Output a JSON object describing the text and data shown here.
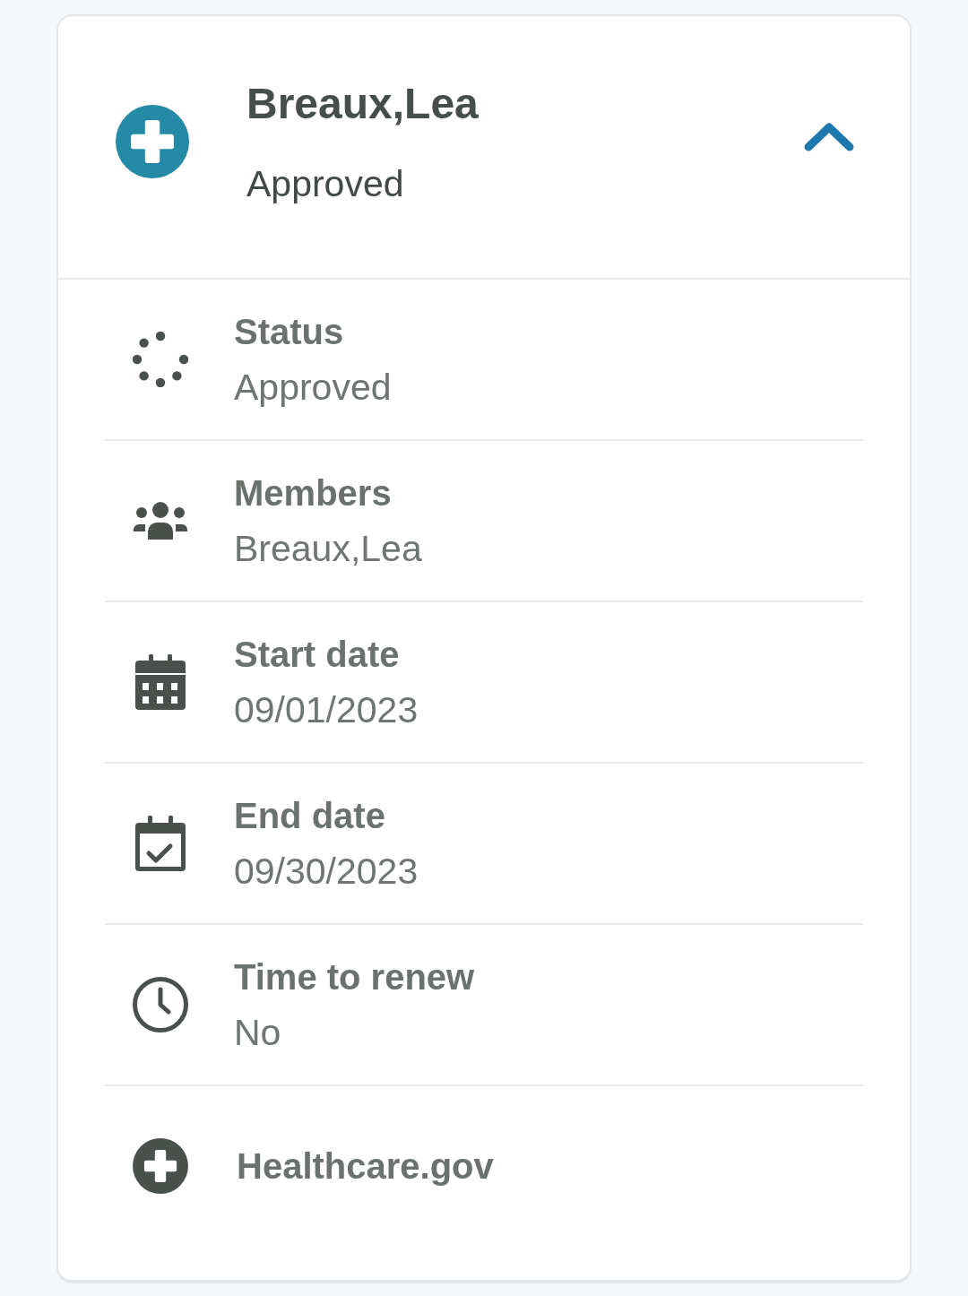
{
  "header": {
    "title": "Breaux,Lea",
    "subtitle": "Approved",
    "expanded": true
  },
  "details": [
    {
      "kind": "status",
      "label": "Status",
      "value": "Approved"
    },
    {
      "kind": "members",
      "label": "Members",
      "value": "Breaux,Lea"
    },
    {
      "kind": "start_date",
      "label": "Start date",
      "value": "09/01/2023"
    },
    {
      "kind": "end_date",
      "label": "End date",
      "value": "09/30/2023"
    },
    {
      "kind": "renewal",
      "label": "Time to renew",
      "value": "No"
    }
  ],
  "link": {
    "label": "Healthcare.gov"
  }
}
